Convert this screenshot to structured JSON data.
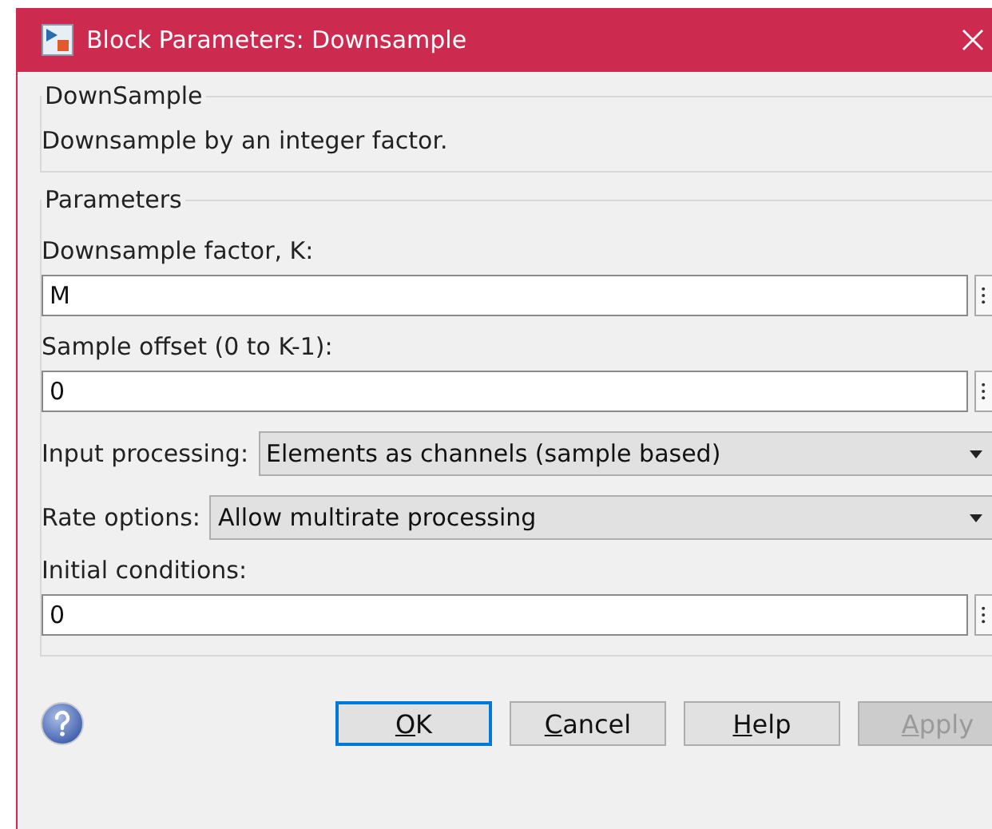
{
  "window": {
    "title": "Block Parameters: Downsample"
  },
  "description_group": {
    "title": "DownSample",
    "text": "Downsample by an integer factor."
  },
  "parameters": {
    "title": "Parameters",
    "fields": [
      {
        "kind": "edit",
        "label": "Downsample factor, K:",
        "value": "M"
      },
      {
        "kind": "edit",
        "label": "Sample offset (0 to K-1):",
        "value": "0"
      },
      {
        "kind": "popup",
        "label": "Input processing:",
        "value": "Elements as channels (sample based)"
      },
      {
        "kind": "popup",
        "label": "Rate options:",
        "value": "Allow multirate processing"
      },
      {
        "kind": "edit",
        "label": "Initial conditions:",
        "value": "0"
      }
    ]
  },
  "buttons": [
    {
      "access_key": "O",
      "rest": "K",
      "default": true,
      "disabled": false
    },
    {
      "access_key": "C",
      "rest": "ancel",
      "default": false,
      "disabled": false
    },
    {
      "access_key": "H",
      "rest": "elp",
      "default": false,
      "disabled": false
    },
    {
      "access_key": "A",
      "rest": "pply",
      "default": false,
      "disabled": true
    }
  ]
}
